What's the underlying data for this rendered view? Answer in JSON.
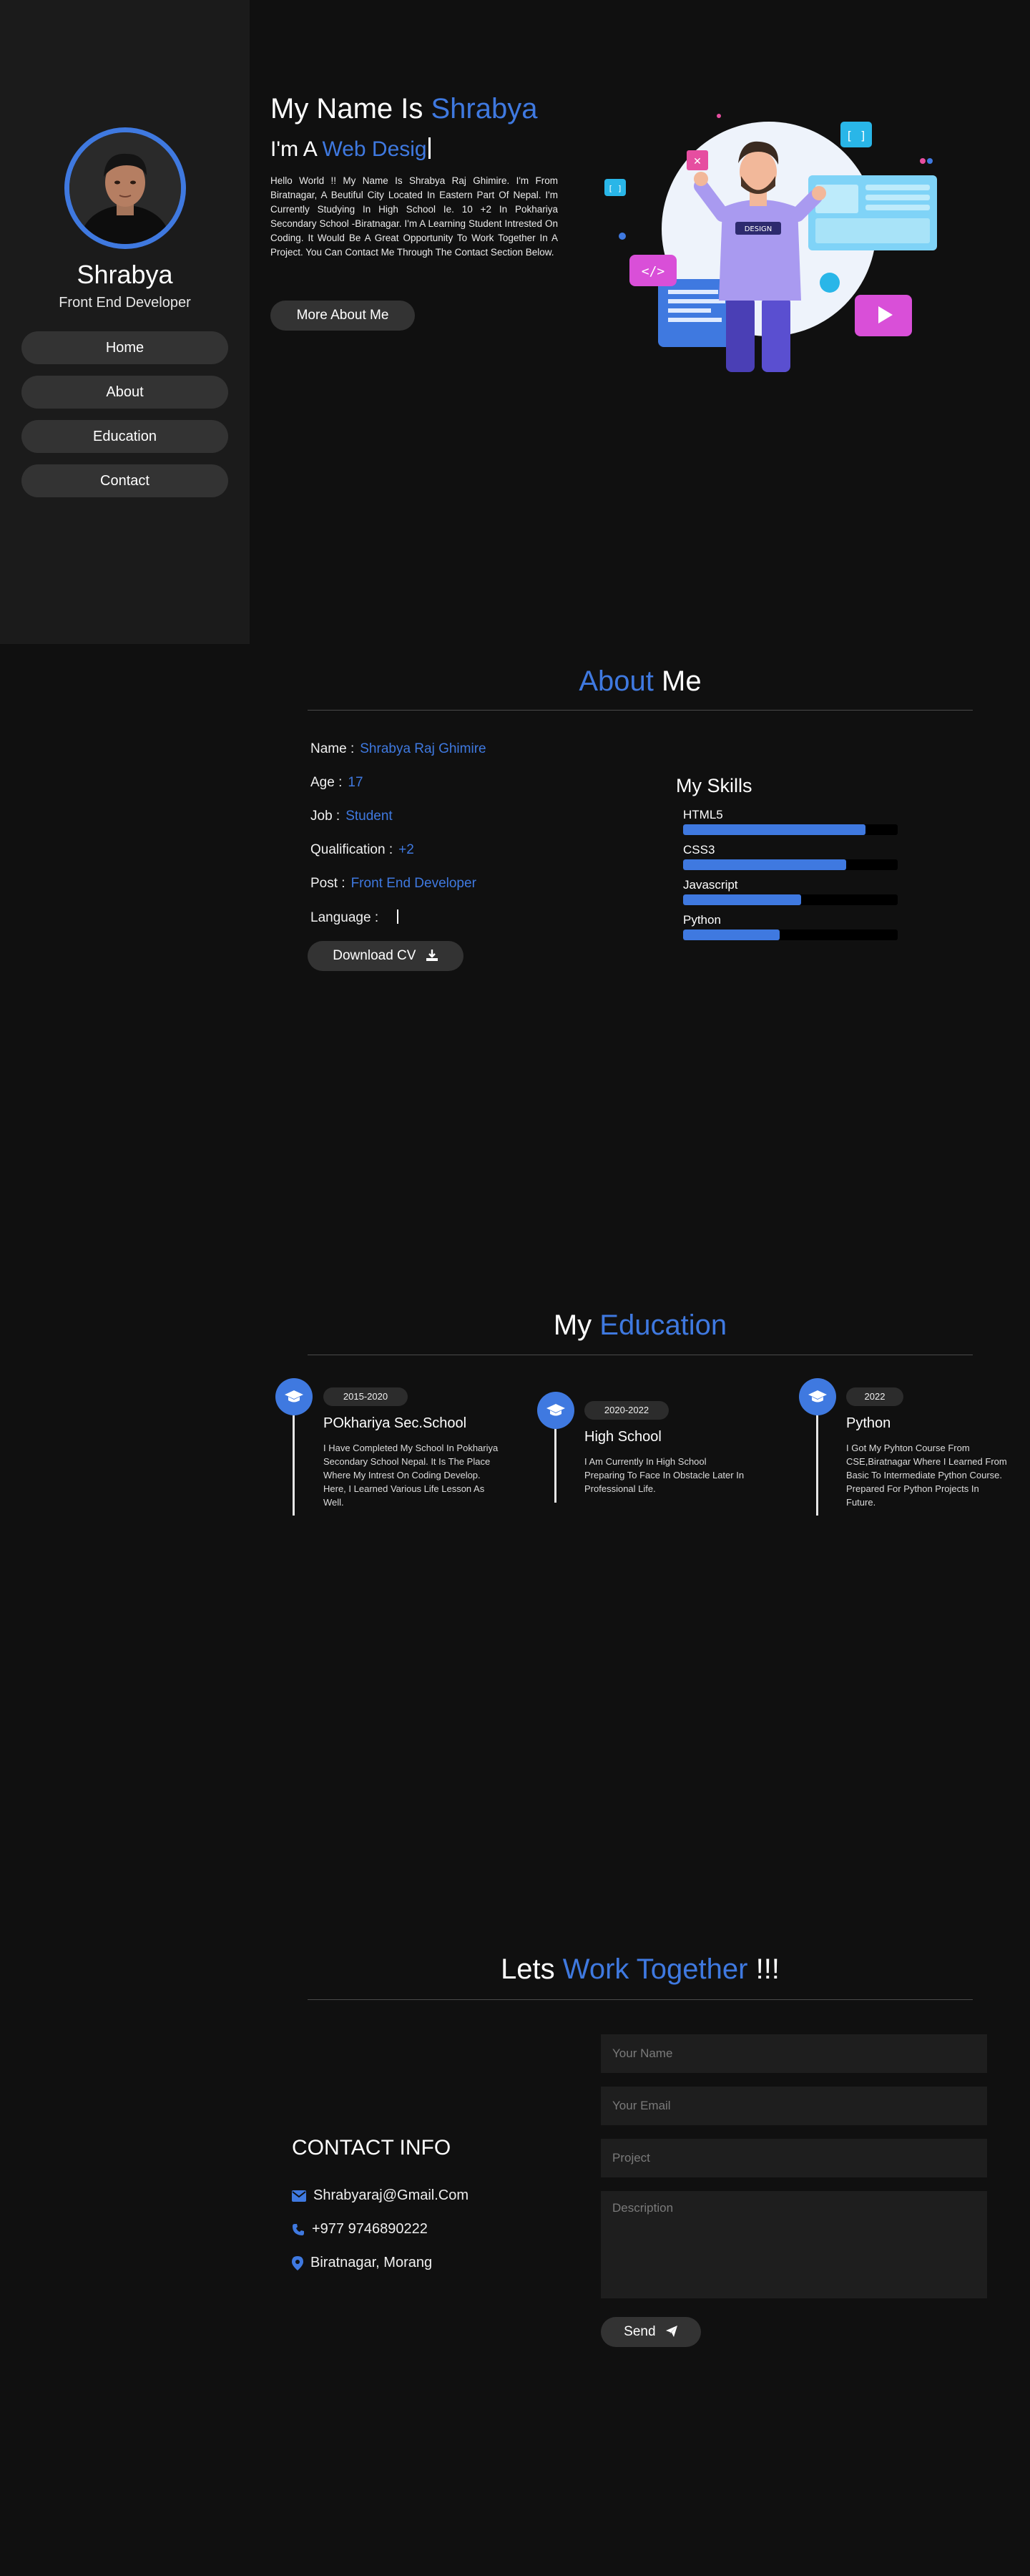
{
  "sidebar": {
    "name": "Shrabya",
    "role": "Front End Developer",
    "nav": [
      {
        "label": "Home"
      },
      {
        "label": "About"
      },
      {
        "label": "Education"
      },
      {
        "label": "Contact"
      }
    ]
  },
  "hero": {
    "title_prefix": "My Name Is",
    "title_name": "Shrabya",
    "sub_prefix": "I'm A",
    "sub_typed": "Web Desig",
    "bio": "Hello World !! My Name Is Shrabya Raj Ghimire. I'm From Biratnagar, A Beutiful City Located In Eastern Part Of Nepal. I'm Currently Studying In High School Ie. 10 +2 In Pokhariya Secondary School -Biratnagar. I'm A Learning Student Intrested On Coding. It Would Be A Great Opportunity To Work Together In A Project. You Can Contact Me Through The Contact Section Below.",
    "button": "More About Me",
    "illustration_badge": "DESIGN"
  },
  "about": {
    "title_accent": "About",
    "title_rest": "Me",
    "rows": [
      {
        "label": "Name :",
        "value": "Shrabya Raj Ghimire"
      },
      {
        "label": "Age :",
        "value": "17"
      },
      {
        "label": "Job :",
        "value": "Student"
      },
      {
        "label": "Qualification :",
        "value": "+2"
      },
      {
        "label": "Post :",
        "value": "Front End Developer"
      },
      {
        "label": "Language :",
        "value": ""
      }
    ],
    "download_label": "Download CV",
    "skills_title": "My Skills",
    "skills": [
      {
        "name": "HTML5",
        "level": 0.85
      },
      {
        "name": "CSS3",
        "level": 0.76
      },
      {
        "name": "Javascript",
        "level": 0.55
      },
      {
        "name": "Python",
        "level": 0.45
      }
    ]
  },
  "education": {
    "title_prefix": "My",
    "title_accent": "Education",
    "items": [
      {
        "date": "2015-2020",
        "title": "POkhariya Sec.School",
        "desc": "I Have Completed My School In Pokhariya Secondary School Nepal. It Is The Place Where My Intrest On Coding Develop. Here, I Learned Various Life Lesson As Well."
      },
      {
        "date": "2020-2022",
        "title": "High School",
        "desc": "I Am Currently In High School Preparing To Face In Obstacle Later In Professional Life."
      },
      {
        "date": "2022",
        "title": "Python",
        "desc": "I Got My Pyhton Course From CSE,Biratnagar Where I Learned From Basic To Intermediate Python Course. Prepared For Python Projects In Future."
      }
    ]
  },
  "contact": {
    "title_prefix": "Lets",
    "title_accent": "Work Together",
    "title_suffix": "!!!",
    "info_heading": "CONTACT INFO",
    "email": "Shrabyaraj@Gmail.Com",
    "phone": "+977 9746890222",
    "location": "Biratnagar, Morang",
    "placeholders": {
      "name": "Your Name",
      "email": "Your Email",
      "project": "Project",
      "description": "Description"
    },
    "send_label": "Send"
  },
  "colors": {
    "accent": "#3f79e0",
    "background": "#101010",
    "sidebar": "#1b1b1b",
    "button": "#333333"
  }
}
